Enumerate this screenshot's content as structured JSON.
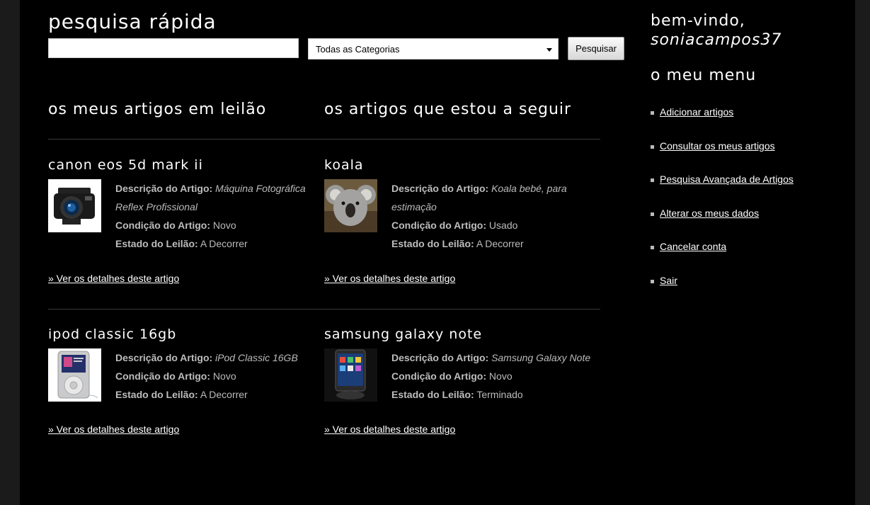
{
  "search": {
    "title": "pesquisa rápida",
    "input_value": "",
    "category_selected": "Todas as Categorias",
    "button_label": "Pesquisar"
  },
  "columns": {
    "my_auctions_title": "os meus artigos em leilão",
    "following_title": "os artigos que estou a seguir"
  },
  "labels": {
    "description": "Descrição do Artigo:",
    "condition": "Condição do Artigo:",
    "status": "Estado do Leilão:",
    "details_link": "» Ver os detalhes deste artigo"
  },
  "my_items": [
    {
      "title": "canon eos 5d mark ii",
      "description": "Máquina Fotográfica Reflex Profissional",
      "condition": "Novo",
      "status": "A Decorrer",
      "image_icon": "camera-image"
    },
    {
      "title": "ipod classic 16gb",
      "description": "iPod Classic 16GB",
      "condition": "Novo",
      "status": "A Decorrer",
      "image_icon": "ipod-image"
    }
  ],
  "followed_items": [
    {
      "title": "koala",
      "description": "Koala bebé, para estimação",
      "condition": "Usado",
      "status": "A Decorrer",
      "image_icon": "koala-image"
    },
    {
      "title": "samsung galaxy note",
      "description": "Samsung Galaxy Note",
      "condition": "Novo",
      "status": "Terminado",
      "image_icon": "phone-image"
    }
  ],
  "sidebar": {
    "welcome": "bem-vindo,",
    "username": "soniacampos37",
    "menu_title": "o meu menu",
    "menu_items": [
      "Adicionar artigos",
      "Consultar os meus artigos",
      "Pesquisa Avançada de Artigos",
      "Alterar os meus dados",
      "Cancelar conta",
      "Sair"
    ]
  },
  "colors": {
    "background": "#000000",
    "outer_background": "#1b1b1b",
    "text": "#ffffff",
    "muted_text": "#bbbbbb"
  }
}
